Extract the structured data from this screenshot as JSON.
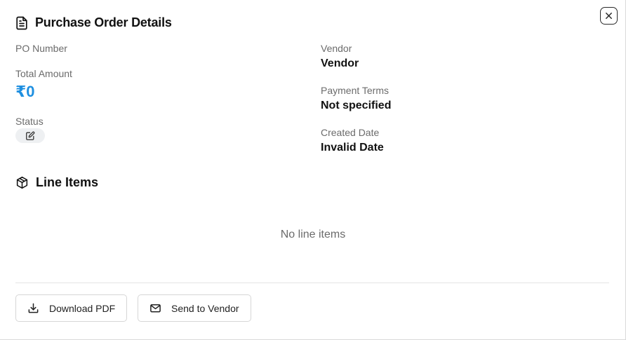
{
  "modal": {
    "title": "Purchase Order Details",
    "close_icon": "x-icon",
    "title_icon": "file-text-icon"
  },
  "details": {
    "po_number_label": "PO Number",
    "po_number_value": "",
    "total_amount_label": "Total Amount",
    "total_amount_value": "₹0",
    "status_label": "Status",
    "status_icon": "edit-icon",
    "vendor_label": "Vendor",
    "vendor_value": "Vendor",
    "payment_terms_label": "Payment Terms",
    "payment_terms_value": "Not specified",
    "created_date_label": "Created Date",
    "created_date_value": "Invalid Date"
  },
  "line_items": {
    "title": "Line Items",
    "icon": "package-icon",
    "empty_text": "No line items"
  },
  "actions": {
    "download_label": "Download PDF",
    "download_icon": "download-icon",
    "send_label": "Send to Vendor",
    "send_icon": "mail-icon"
  },
  "colors": {
    "accent": "#1e8fe0",
    "muted_text": "#6b6b6b",
    "chip_bg": "#eef0f2"
  }
}
